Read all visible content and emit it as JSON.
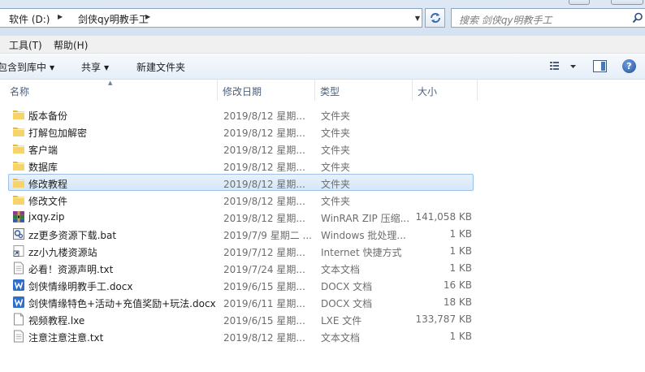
{
  "address": {
    "breadcrumbs": [
      "软件 (D:)",
      "剑侠qy明教手工"
    ]
  },
  "search": {
    "placeholder": "搜索 剑侠qy明教手工"
  },
  "menu": {
    "items": [
      "工具(T)",
      "帮助(H)"
    ]
  },
  "toolbar": {
    "include_library": "包含到库中",
    "share": "共享",
    "new_folder": "新建文件夹"
  },
  "columns": {
    "name": "名称",
    "date": "修改日期",
    "type": "类型",
    "size": "大小"
  },
  "files": [
    {
      "name": "版本备份",
      "date": "2019/8/12 星期...",
      "type": "文件夹",
      "size": "",
      "icon": "folder-icon"
    },
    {
      "name": "打解包加解密",
      "date": "2019/8/12 星期...",
      "type": "文件夹",
      "size": "",
      "icon": "folder-icon"
    },
    {
      "name": "客户端",
      "date": "2019/8/12 星期...",
      "type": "文件夹",
      "size": "",
      "icon": "folder-icon"
    },
    {
      "name": "数据库",
      "date": "2019/8/12 星期...",
      "type": "文件夹",
      "size": "",
      "icon": "folder-icon"
    },
    {
      "name": "修改教程",
      "date": "2019/8/12 星期...",
      "type": "文件夹",
      "size": "",
      "icon": "folder-icon",
      "selected": true
    },
    {
      "name": "修改文件",
      "date": "2019/8/12 星期...",
      "type": "文件夹",
      "size": "",
      "icon": "folder-icon"
    },
    {
      "name": "jxqy.zip",
      "date": "2019/8/12 星期...",
      "type": "WinRAR ZIP 压缩...",
      "size": "141,058 KB",
      "icon": "winrar-icon"
    },
    {
      "name": "zz更多资源下载.bat",
      "date": "2019/7/9 星期二 ...",
      "type": "Windows 批处理...",
      "size": "1 KB",
      "icon": "batch-file-icon"
    },
    {
      "name": "zz小九楼资源站",
      "date": "2019/7/12 星期...",
      "type": "Internet 快捷方式",
      "size": "1 KB",
      "icon": "shortcut-icon"
    },
    {
      "name": "必看！资源声明.txt",
      "date": "2019/7/24 星期...",
      "type": "文本文档",
      "size": "1 KB",
      "icon": "text-file-icon"
    },
    {
      "name": "剑侠情缘明教手工.docx",
      "date": "2019/6/15 星期...",
      "type": "DOCX 文档",
      "size": "16 KB",
      "icon": "word-doc-icon"
    },
    {
      "name": "剑侠情缘特色+活动+充值奖励+玩法.docx",
      "date": "2019/6/11 星期...",
      "type": "DOCX 文档",
      "size": "18 KB",
      "icon": "word-doc-icon"
    },
    {
      "name": "视频教程.lxe",
      "date": "2019/6/15 星期...",
      "type": "LXE 文件",
      "size": "133,787 KB",
      "icon": "blank-file-icon"
    },
    {
      "name": "注意注意注意.txt",
      "date": "2019/8/12 星期...",
      "type": "文本文档",
      "size": "1 KB",
      "icon": "text-file-icon"
    }
  ]
}
